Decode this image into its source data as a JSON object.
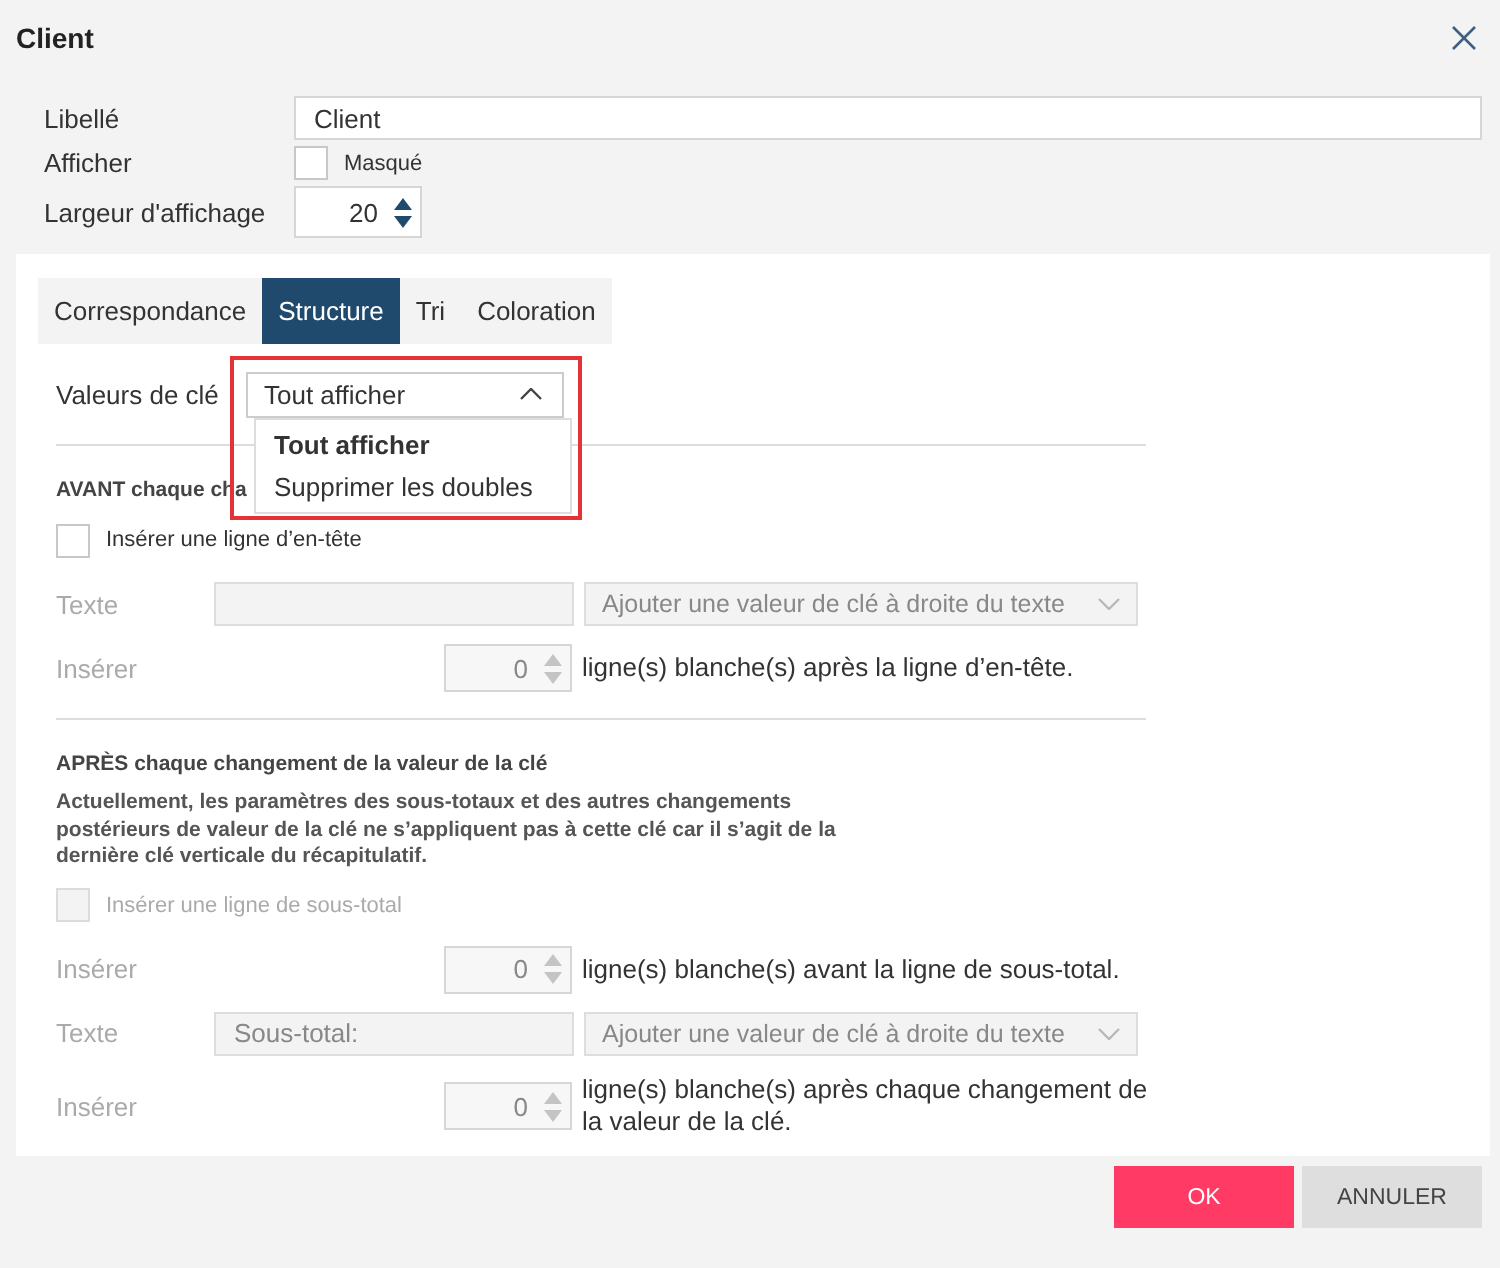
{
  "dialog": {
    "title": "Client"
  },
  "fields": {
    "caption": {
      "label": "Libellé",
      "value": "Client"
    },
    "display": {
      "label": "Afficher",
      "checkbox_label": "Masqué",
      "checked": false
    },
    "width": {
      "label": "Largeur d'affichage",
      "value": "20"
    }
  },
  "tabs": [
    {
      "label": "Correspondance",
      "selected": false
    },
    {
      "label": "Structure",
      "selected": true
    },
    {
      "label": "Tri",
      "selected": false
    },
    {
      "label": "Coloration",
      "selected": false
    }
  ],
  "key_values": {
    "label": "Valeurs de clé",
    "value": "Tout afficher",
    "expanded": true,
    "options": [
      {
        "label": "Tout afficher",
        "selected": true
      },
      {
        "label": "Supprimer les doubles",
        "selected": false
      }
    ]
  },
  "sections": [
    {
      "heading": "AVANT chaque cha",
      "rows": [
        {
          "kind": "checkbox",
          "label": "Insérer une ligne d’en-tête",
          "checked": false,
          "disabled": false
        },
        {
          "kind": "text",
          "label": "Texte",
          "select": "Ajouter une valeur de clé à droite du texte",
          "disabled": true
        },
        {
          "kind": "spin",
          "label": "Insérer",
          "value": "0",
          "suffix": "ligne(s) blanche(s) après la ligne d’en-tête.",
          "disabled": true
        }
      ]
    },
    {
      "heading": "APRÈS chaque changement de la valeur de la clé",
      "note": "Actuellement, les paramètres des sous-totaux et des autres changements postérieurs de valeur de la clé ne s’appliquent pas à cette clé car il s’agit de la dernière clé verticale du récapitulatif.",
      "rows": [
        {
          "kind": "checkbox",
          "label": "Insérer une ligne de sous-total",
          "checked": false,
          "disabled": true
        },
        {
          "kind": "spin",
          "label": "Insérer",
          "value": "0",
          "suffix": "ligne(s) blanche(s) avant la ligne de sous-total.",
          "disabled": true
        },
        {
          "kind": "text",
          "label": "Texte",
          "value": "Sous-total:",
          "select": "Ajouter une valeur de clé à droite du texte",
          "disabled": true
        },
        {
          "kind": "spin",
          "label": "Insérer",
          "value": "0",
          "suffix": "ligne(s) blanche(s) après chaque changement de la valeur de la clé.",
          "disabled": true
        }
      ]
    }
  ],
  "buttons": [
    {
      "label": "OK",
      "kind": "primary"
    },
    {
      "label": "ANNULER",
      "kind": "secondary"
    }
  ]
}
